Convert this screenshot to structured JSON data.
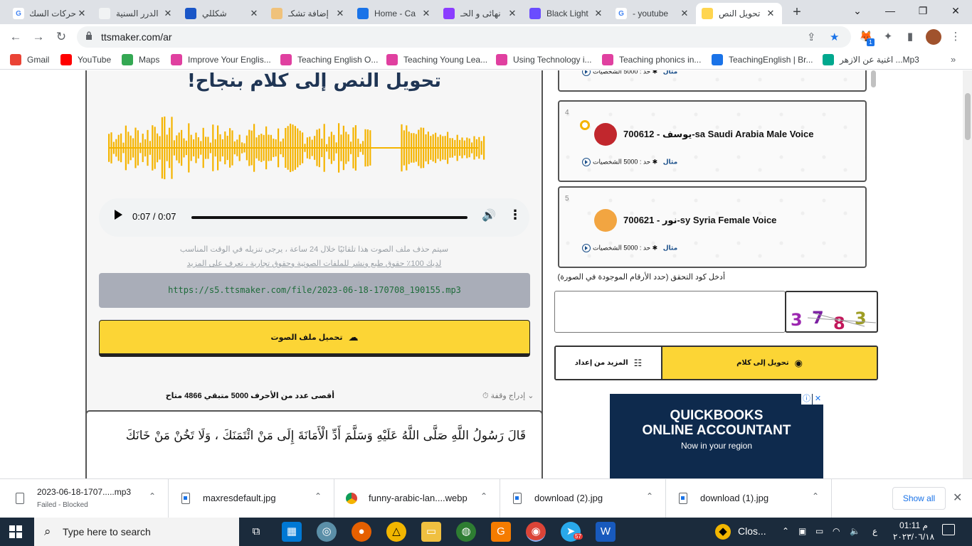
{
  "tabs": [
    {
      "title": "حركات السك",
      "fav": "G",
      "color": "#ffffff",
      "fgcolor": "#4285f4"
    },
    {
      "title": "الدرر السنية",
      "fav": "",
      "color": "#f1f3f4",
      "fgcolor": "#555"
    },
    {
      "title": "شكللي",
      "fav": "",
      "color": "#1a56c7",
      "fgcolor": "#fff"
    },
    {
      "title": "إضافة تشكـ",
      "fav": "",
      "color": "#f0c27b",
      "fgcolor": "#fff"
    },
    {
      "title": "Home - Ca",
      "fav": "",
      "color": "#1a73e8",
      "fgcolor": "#fff"
    },
    {
      "title": "نهائى و الحـ",
      "fav": "",
      "color": "#8b3dff",
      "fgcolor": "#fff"
    },
    {
      "title": "Black Light",
      "fav": "",
      "color": "#6a4cff",
      "fgcolor": "#fff"
    },
    {
      "title": "youtube - ",
      "fav": "G",
      "color": "#ffffff",
      "fgcolor": "#4285f4"
    },
    {
      "title": "تحويل النص",
      "fav": "",
      "color": "#ffd54f",
      "fgcolor": "#000",
      "active": true
    }
  ],
  "toolbar": {
    "url": "ttsmaker.com/ar",
    "ext_badge": "1"
  },
  "bookmarks": [
    {
      "label": "Gmail",
      "color": "#ea4335"
    },
    {
      "label": "YouTube",
      "color": "#ff0000"
    },
    {
      "label": "Maps",
      "color": "#34a853"
    },
    {
      "label": "Improve Your Englis...",
      "color": "#e040a0"
    },
    {
      "label": "Teaching English O...",
      "color": "#e040a0"
    },
    {
      "label": "Teaching Young Lea...",
      "color": "#e040a0"
    },
    {
      "label": "Using Technology i...",
      "color": "#e040a0"
    },
    {
      "label": "Teaching phonics in...",
      "color": "#e040a0"
    },
    {
      "label": "TeachingEnglish | Br...",
      "color": "#1a73e8"
    },
    {
      "label": "اغنية عن الازهر ...Mp3",
      "color": "#00a88e"
    }
  ],
  "result": {
    "title": "!تحويل النص إلى كلام بنجاح",
    "time": "0:07 / 0:07",
    "note_line1": "سيتم حذف ملف الصوت هذا تلقائيًا خلال 24 ساعة ، يرجى تنزيله في الوقت المناسب",
    "note_line2": "لديك 100٪ حقوق طبع ونشر للملفات الصوتية وحقوق تجارية ، تعرف على المزيد",
    "file_url": "https://s5.ttsmaker.com/file/2023-06-18-170708_190155.mp3",
    "download_label": "تحميل ملف الصوت"
  },
  "counter": {
    "insert_label": "إدراج وقفة",
    "limits": "أقصى عدد من الأحرف 5000 متبقي 4866 متاح"
  },
  "input_text": "قَالَ رَسُولُ اللَّهِ صَلَّى اللَّهُ عَلَيْهِ وَسَلَّمَ أَدِّ الْأَمَانَةَ إِلَى مَنْ ائْتَمَنَكَ ، وَلَا تَخُنْ مَنْ خَانَكَ",
  "voices": [
    {
      "num": "",
      "name": "",
      "meta": "حد : 5000 الشخصيات",
      "sample": "مثال"
    },
    {
      "num": "4",
      "name": "700612 - يوسف-sa Saudi Arabia Male Voice",
      "meta": "حد : 5000 الشخصيات",
      "sample": "مثال",
      "selected": true
    },
    {
      "num": "5",
      "name": "700621 - نور-sy Syria Female Voice",
      "meta": "حد : 5000 الشخصيات",
      "sample": "مثال"
    }
  ],
  "captcha": {
    "label": "أدخل كود التحقق (حدد الأرقام الموجودة في الصورة)",
    "digits": [
      "3",
      "7",
      "8",
      "3"
    ]
  },
  "buttons": {
    "convert": "تحويل إلى كلام",
    "more_settings": "المزيد من إعداد"
  },
  "ad": {
    "headline1": "QUICKBOOKS",
    "headline2": "ONLINE ACCOUNTANT",
    "sub": "Now in your region"
  },
  "downloads": [
    {
      "name": "2023-06-18-1707.....mp3",
      "status": "Failed - Blocked"
    },
    {
      "name": "maxresdefault.jpg",
      "status": ""
    },
    {
      "name": "funny-arabic-lan....webp",
      "status": ""
    },
    {
      "name": "download (2).jpg",
      "status": ""
    },
    {
      "name": "download (1).jpg",
      "status": ""
    }
  ],
  "download_bar": {
    "show_all": "Show all"
  },
  "taskbar": {
    "search_placeholder": "Type here to search",
    "weather": "Clos...",
    "lang": "ع",
    "time": "01:11 م",
    "date": "٢٠٢٣/٠٦/١٨",
    "telegram_badge": "57"
  }
}
